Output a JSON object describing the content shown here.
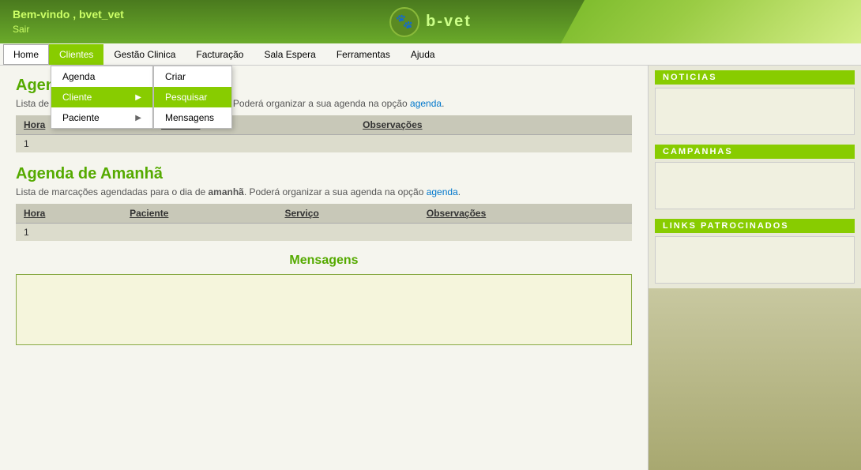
{
  "header": {
    "welcome": "Bem-vindo , bvet_vet",
    "sair": "Sair",
    "logo_text": "b-vet",
    "logo_icon": "🐾"
  },
  "navbar": {
    "items": [
      {
        "id": "home",
        "label": "Home",
        "state": "home"
      },
      {
        "id": "clientes",
        "label": "Clientes",
        "state": "active"
      },
      {
        "id": "gestao",
        "label": "Gestão Clinica",
        "state": "normal"
      },
      {
        "id": "facturacao",
        "label": "Facturação",
        "state": "normal"
      },
      {
        "id": "sala",
        "label": "Sala Espera",
        "state": "normal"
      },
      {
        "id": "ferramentas",
        "label": "Ferramentas",
        "state": "normal"
      },
      {
        "id": "ajuda",
        "label": "Ajuda",
        "state": "normal"
      }
    ]
  },
  "dropdown_clientes": {
    "items": [
      {
        "id": "agenda",
        "label": "Agenda",
        "has_arrow": false
      },
      {
        "id": "cliente",
        "label": "Cliente",
        "has_arrow": true,
        "highlighted": true
      },
      {
        "id": "paciente",
        "label": "Paciente",
        "has_arrow": true
      }
    ]
  },
  "submenu_cliente": {
    "items": [
      {
        "id": "criar",
        "label": "Criar"
      },
      {
        "id": "pesquisar",
        "label": "Pesquisar",
        "highlighted": true
      },
      {
        "id": "mensagens",
        "label": "Mensagens"
      }
    ]
  },
  "agenda_hoje": {
    "title": "Agenda de Hoje",
    "description": "Lista de marcações agendadas para o dia de hoje. Poderá organizar a sua agenda na opção agenda.",
    "desc_link": "agenda",
    "columns": [
      "Hora",
      "Paciente",
      "Observações"
    ],
    "rows": [
      [
        "1",
        "",
        ""
      ]
    ]
  },
  "agenda_amanha": {
    "title": "Agenda de Amanhã",
    "description": "Lista de marcações agendadas para o dia de amanhã. Poderá organizar a sua agenda na opção agenda.",
    "desc_link": "agenda",
    "columns": [
      "Hora",
      "Paciente",
      "Serviço",
      "Observações"
    ],
    "rows": [
      [
        "1",
        "",
        "",
        ""
      ]
    ]
  },
  "messages": {
    "title": "Mensagens",
    "placeholder": ""
  },
  "sidebar": {
    "noticias_label": "Noticias",
    "campanhas_label": "Campanhas",
    "links_label": "Links Patrocinados"
  }
}
